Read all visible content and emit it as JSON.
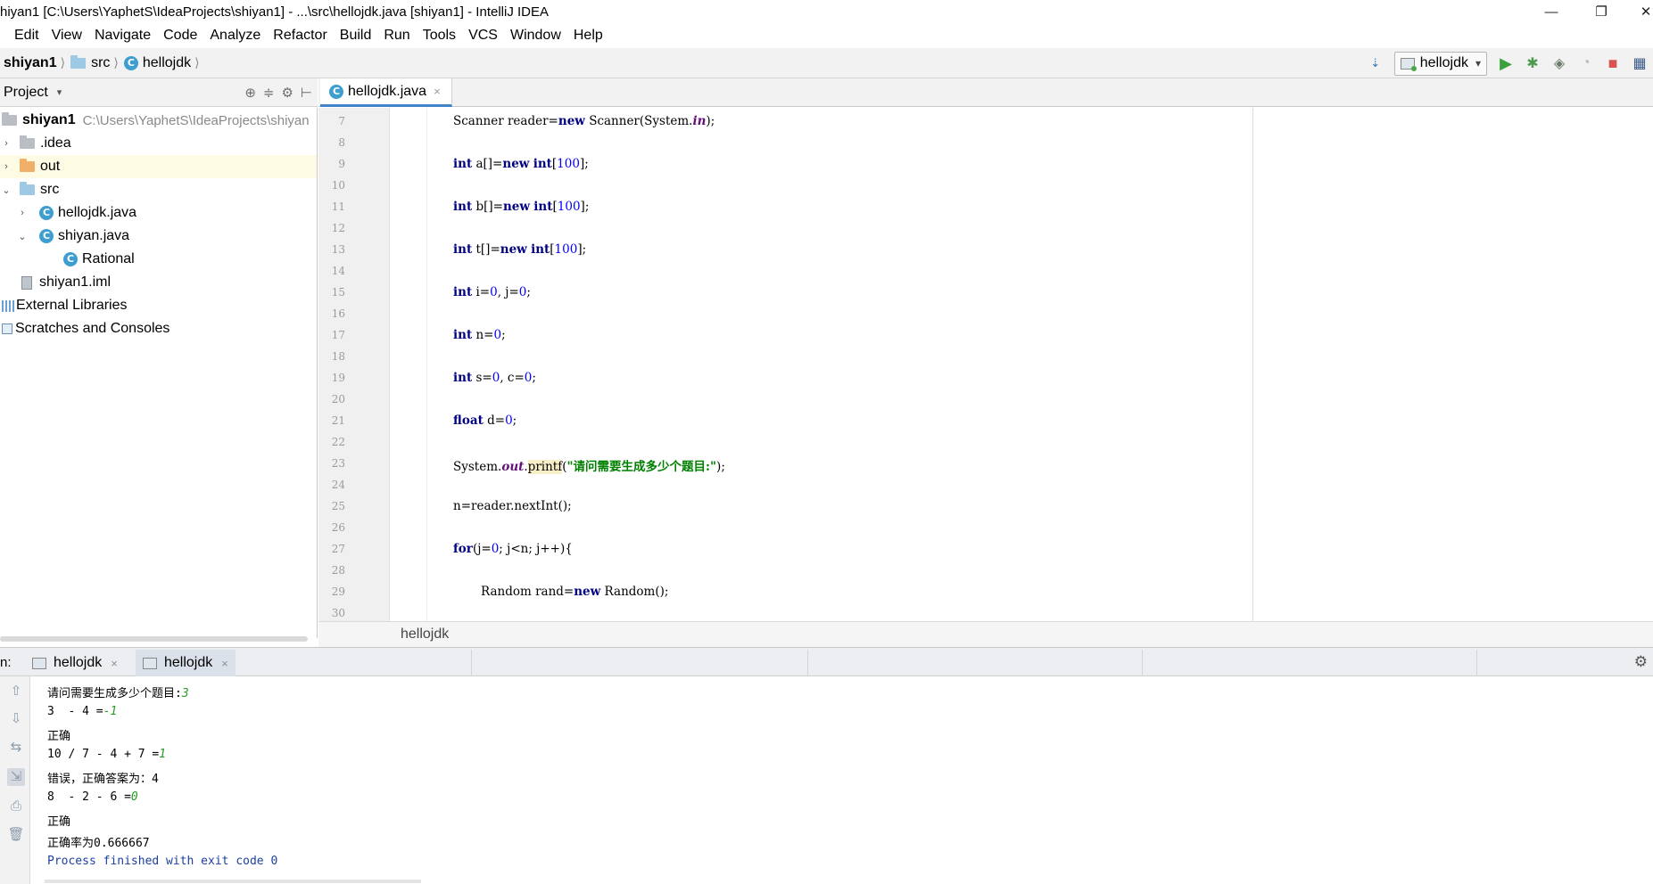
{
  "window": {
    "title": "hiyan1 [C:\\Users\\YaphetS\\IdeaProjects\\shiyan1] - ...\\src\\hellojdk.java [shiyan1] - IntelliJ IDEA",
    "minimize_glyph": "—",
    "restore_glyph": "❐",
    "close_glyph": "✕"
  },
  "menu": [
    "Edit",
    "View",
    "Navigate",
    "Code",
    "Analyze",
    "Refactor",
    "Build",
    "Run",
    "Tools",
    "VCS",
    "Window",
    "Help"
  ],
  "nav": {
    "crumbs": [
      "shiyan1",
      "src",
      "hellojdk"
    ],
    "run_config": "hellojdk"
  },
  "icons": {
    "class_letter": "C",
    "chevron": "⟩",
    "dropdown": "▾",
    "run": "▶",
    "debug": "✱",
    "coverage": "◈",
    "profile": "◔",
    "stop": "■",
    "layout": "▦",
    "locate": "⊕",
    "collapse": "≑",
    "gear": "⚙",
    "hide": "⊢",
    "arrow_right": "›",
    "arrow_down": "⌄",
    "up": "⇧",
    "down": "⇩",
    "wrap": "⇆",
    "scroll_end": "⇲",
    "print": "⎙",
    "trash": "🗑",
    "close": "×"
  },
  "project": {
    "header": "Project",
    "tree": [
      {
        "label": "shiyan1",
        "path": "C:\\Users\\YaphetS\\IdeaProjects\\shiyan",
        "type": "module"
      },
      {
        "label": ".idea",
        "type": "folder"
      },
      {
        "label": "out",
        "type": "folder-orange"
      },
      {
        "label": "src",
        "type": "folder"
      },
      {
        "label": "hellojdk.java",
        "type": "class"
      },
      {
        "label": "shiyan.java",
        "type": "class"
      },
      {
        "label": "Rational",
        "type": "class"
      },
      {
        "label": "shiyan1.iml",
        "type": "file"
      },
      {
        "label": "External Libraries",
        "type": "libs"
      },
      {
        "label": "Scratches and Consoles",
        "type": "scratch"
      }
    ]
  },
  "editor": {
    "tab": "hellojdk.java",
    "breadcrumb": "hellojdk",
    "line_numbers": [
      "7",
      "8",
      "9",
      "10",
      "11",
      "12",
      "13",
      "14",
      "15",
      "16",
      "17",
      "18",
      "19",
      "20",
      "21",
      "22",
      "23",
      "24",
      "25",
      "26",
      "27",
      "28",
      "29",
      "30"
    ],
    "code": {
      "l7a": "Scanner reader=",
      "l7kw": "new",
      "l7b": " Scanner(System.",
      "l7fld": "in",
      "l7c": ");",
      "int_kw": "int",
      "new_kw": "new",
      "l9a": " a[]=",
      "l9b": "[",
      "l9n": "100",
      "l9c": "];",
      "l11a": " b[]=",
      "l13a": " t[]=",
      "l15a": " i=",
      "l15n1": "0",
      "l15b": ", j=",
      "l15n2": "0",
      "l15c": ";",
      "l17a": " n=",
      "l17n": "0",
      "l17c": ";",
      "l19a": " s=",
      "l19n1": "0",
      "l19b": ", c=",
      "l19n2": "0",
      "l19c": ";",
      "float_kw": "float",
      "l21a": " d=",
      "l21n": "0",
      "l21c": ";",
      "l23a": "System.",
      "l23fld": "out",
      "l23dot": ".",
      "l23m": "printf",
      "l23b": "(",
      "l23s": "\"请问需要生成多少个题目:\"",
      "l23c": ");",
      "l25": "n=reader.nextInt();",
      "for_kw": "for",
      "l27a": "(j=",
      "l27n": "0",
      "l27b": "; j<n; j++){",
      "l29a": "Random rand=",
      "l29b": " Random();"
    }
  },
  "run": {
    "label": "n:",
    "tabs": [
      "hellojdk",
      "hellojdk"
    ],
    "console": {
      "prompt": "请问需要生成多少个题目:",
      "input_1": "3",
      "q1": "3  - 4 =",
      "a1": "-1",
      "r1": "正确",
      "q2": "10 / 7 - 4 + 7 =",
      "a2": "1",
      "r2": "错误，正确答案为：4",
      "q3": "8  - 2 - 6 =",
      "a3": "0",
      "r3": "正确",
      "rate": "正确率为0.666667",
      "process": "Process finished with exit code 0"
    }
  },
  "colors": {
    "keyword": "#000080",
    "number": "#0000ff",
    "string": "#008000",
    "field": "#660e7a",
    "accent": "#4083c9",
    "console_input": "#2a9a2a"
  }
}
